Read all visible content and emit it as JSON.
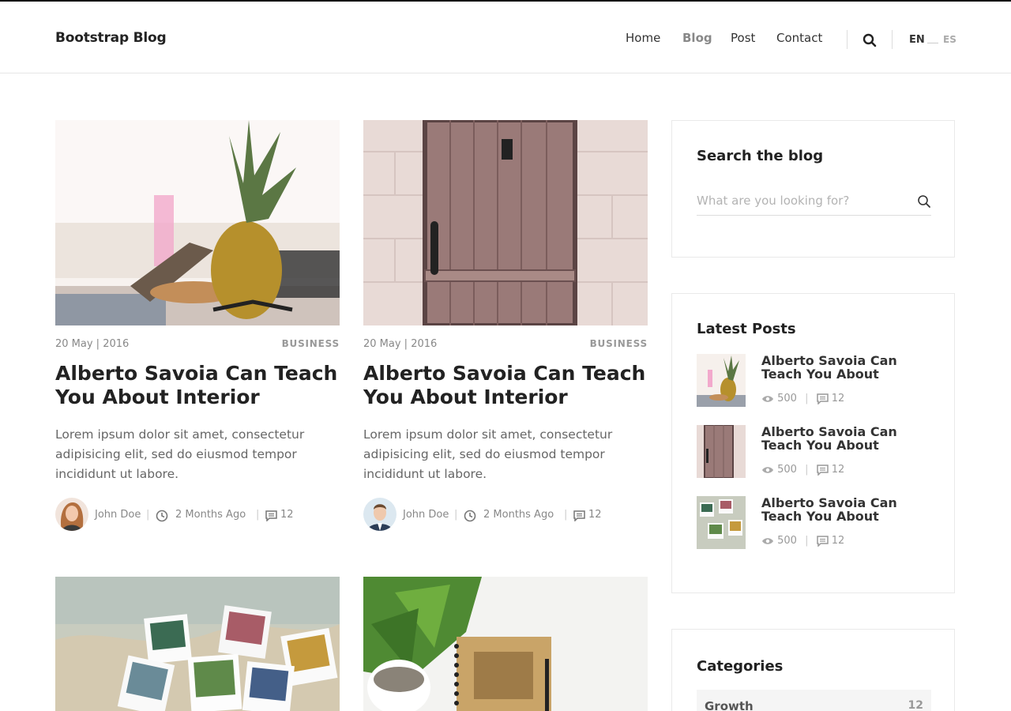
{
  "navbar": {
    "brand": "Bootstrap Blog",
    "links": [
      {
        "label": "Home",
        "active": false
      },
      {
        "label": "Blog",
        "active": true
      },
      {
        "label": "Post",
        "active": false
      },
      {
        "label": "Contact",
        "active": false
      }
    ],
    "search_icon": "search-icon",
    "languages": {
      "current": "EN",
      "other": "ES"
    }
  },
  "posts": [
    {
      "date": "20 May | 2016",
      "category": "BUSINESS",
      "title": "Alberto Savoia Can Teach You About Interior",
      "excerpt": "Lorem ipsum dolor sit amet, consectetur adipisicing elit, sed do eiusmod tempor incididunt ut labore.",
      "author": "John Doe",
      "time": "2 Months Ago",
      "comments": "12",
      "image": "pineapple-on-beach"
    },
    {
      "date": "20 May | 2016",
      "category": "BUSINESS",
      "title": "Alberto Savoia Can Teach You About Interior",
      "excerpt": "Lorem ipsum dolor sit amet, consectetur adipisicing elit, sed do eiusmod tempor incididunt ut labore.",
      "author": "John Doe",
      "time": "2 Months Ago",
      "comments": "12",
      "image": "wooden-door"
    },
    {
      "image": "polaroid-photos-on-map"
    },
    {
      "image": "plant-and-notebook"
    }
  ],
  "sidebar": {
    "search": {
      "title": "Search the blog",
      "placeholder": "What are you looking for?"
    },
    "latest": {
      "title": "Latest Posts",
      "items": [
        {
          "title": "Alberto Savoia Can Teach You About",
          "views": "500",
          "comments": "12"
        },
        {
          "title": "Alberto Savoia Can Teach You About",
          "views": "500",
          "comments": "12"
        },
        {
          "title": "Alberto Savoia Can Teach You About",
          "views": "500",
          "comments": "12"
        }
      ]
    },
    "categories": {
      "title": "Categories",
      "items": [
        {
          "name": "Growth",
          "count": "12"
        }
      ]
    }
  },
  "colors": {
    "text_dark": "#222222",
    "text_muted": "#888888",
    "border": "#e6e6e6",
    "active_nav": "#888888"
  }
}
